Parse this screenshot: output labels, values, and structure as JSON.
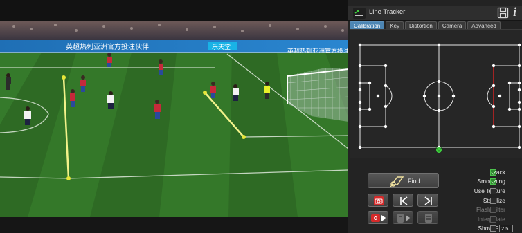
{
  "app": {
    "title": "Line Tracker",
    "logo_icon": "line-tracker-logo-icon",
    "save_icon": "floppy-disk-icon",
    "info_label": "i"
  },
  "tabs": [
    {
      "label": "Calibration",
      "active": true
    },
    {
      "label": "Key",
      "active": false
    },
    {
      "label": "Distortion",
      "active": false
    },
    {
      "label": "Camera",
      "active": false
    },
    {
      "label": "Advanced",
      "active": false
    }
  ],
  "buttons": {
    "find_label": "Find",
    "find_icon": "find-lines-icon",
    "snapshot_icon": "camera-icon",
    "prev_icon": "jump-start-icon",
    "next_icon": "jump-end-icon",
    "record_icon": "camera-play-icon",
    "batch_play_icon": "batch-play-icon",
    "batch_icon": "batch-icon"
  },
  "options": [
    {
      "label": "Track",
      "checked": true,
      "enabled": true
    },
    {
      "label": "Smoothing",
      "checked": true,
      "enabled": true
    },
    {
      "label": "Use Texture",
      "checked": false,
      "enabled": true
    },
    {
      "label": "Stabilize",
      "checked": false,
      "enabled": true
    },
    {
      "label": "Flash Filter",
      "checked": false,
      "enabled": false
    },
    {
      "label": "Interpolate",
      "checked": false,
      "enabled": false
    },
    {
      "label": "Show Grid",
      "checked": false,
      "enabled": true
    }
  ],
  "grid_size": "2.5",
  "video": {
    "ad_boards": [
      "英超热刺亚洲官方投注伙伴",
      "乐天堂",
      "英超热刺亚洲官方投注"
    ]
  },
  "colors": {
    "accent": "#4d86b4",
    "check_on": "#2f8a2f",
    "tracked_line": "#f2f28a",
    "key_point": "#e6e63a",
    "highlight_line": "#cc2222",
    "camera_marker": "#3ed13e"
  }
}
